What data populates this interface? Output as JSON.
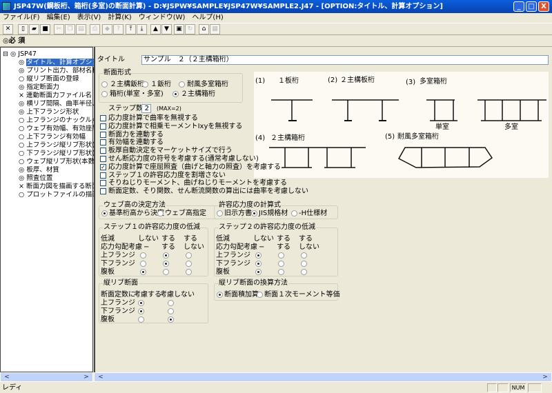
{
  "window": {
    "title": "JSP47W(鋼板桁、箱桁(多室)の断面計算) - D:¥JSPW¥SAMPLE¥JSP47W¥SAMPLE2.J47 - [OPTION:タイトル、計算オプション]",
    "minimize": "_",
    "maximize": "□",
    "close": "X"
  },
  "menu": [
    "ファイル(F)",
    "編集(E)",
    "表示(V)",
    "計算(K)",
    "ウィンドウ(W)",
    "ヘルプ(H)"
  ],
  "toolbar": [
    {
      "icon": "close-icon",
      "glyph": "✕"
    },
    {
      "icon": "new-file-icon",
      "glyph": "▯"
    },
    {
      "icon": "open-folder-icon",
      "glyph": "▰"
    },
    {
      "icon": "save-icon",
      "glyph": "■"
    },
    {
      "icon": "cut-icon",
      "glyph": "✂",
      "disabled": true
    },
    {
      "icon": "copy-icon",
      "glyph": "❐",
      "disabled": true
    },
    {
      "icon": "paste-icon",
      "glyph": "▤",
      "disabled": true
    },
    {
      "icon": "print-icon",
      "glyph": "⎙",
      "disabled": true
    },
    {
      "icon": "eraser-icon",
      "glyph": "◆",
      "disabled": true
    },
    {
      "icon": "help-bulb-icon",
      "glyph": "?",
      "disabled": true
    },
    {
      "icon": "move-top-icon",
      "glyph": "⤒"
    },
    {
      "icon": "move-bottom-icon",
      "glyph": "⤓"
    },
    {
      "icon": "move-up-icon",
      "glyph": "▲"
    },
    {
      "icon": "move-down-icon",
      "glyph": "▼"
    },
    {
      "icon": "window-icon",
      "glyph": "▣"
    },
    {
      "icon": "refresh-icon",
      "glyph": "↻",
      "disabled": true
    },
    {
      "icon": "home-icon",
      "glyph": "⌂"
    },
    {
      "icon": "grid-icon",
      "glyph": "▦",
      "disabled": true
    }
  ],
  "required_bar": "◎必 須",
  "tree": {
    "root": "JSP47",
    "items": [
      {
        "mark": "◎",
        "label": "タイトル、計算オプション",
        "selected": true
      },
      {
        "mark": "◎",
        "label": "プリント出力、部材名称、鋼材"
      },
      {
        "mark": "○",
        "label": "縦リブ断面の登録"
      },
      {
        "mark": "◎",
        "label": "指定断面力"
      },
      {
        "mark": "×",
        "label": "連動断面力ファイル名"
      },
      {
        "mark": "◎",
        "label": "横リブ間隔、曲率半径、ウェブ"
      },
      {
        "mark": "◎",
        "label": "上下フランジ形状"
      },
      {
        "mark": "○",
        "label": "上フランジのナックル点"
      },
      {
        "mark": "○",
        "label": "ウェブ有効幅、有効座屈長"
      },
      {
        "mark": "○",
        "label": "上下フランジ有効幅"
      },
      {
        "mark": "○",
        "label": "上フランジ縦リブ形状(本数、断"
      },
      {
        "mark": "○",
        "label": "下フランジ縦リブ形状(本数、断"
      },
      {
        "mark": "○",
        "label": "ウェブ縦リブ形状(本数、断面、"
      },
      {
        "mark": "◎",
        "label": "板厚、材質"
      },
      {
        "mark": "◎",
        "label": "照査位置"
      },
      {
        "mark": "×",
        "label": "断面力図を描画する断面力フ"
      },
      {
        "mark": "○",
        "label": "プロットファイルの描画スケール"
      }
    ]
  },
  "form": {
    "title_label": "タイトル",
    "title_value": "サンプル　２（２主構箱桁）",
    "section_type": {
      "label": "断面形式",
      "options": [
        "２主構鈑桁",
        "１鈑桁",
        "耐風多室箱桁",
        "箱桁(単室・多室)",
        "２主構箱桁"
      ],
      "selected": "２主構箱桁"
    },
    "steps_label": "ステップ数",
    "steps_value": "2",
    "steps_max": "(MAX=2)",
    "checkboxes": [
      {
        "label": "応力度計算で曲率を無視する",
        "checked": false
      },
      {
        "label": "応力度計算で相乗モーメントIxyを無視する",
        "checked": false
      },
      {
        "label": "断面力を連動する",
        "checked": false
      },
      {
        "label": "有効幅を連動する",
        "checked": false
      },
      {
        "label": "板厚自動決定をマーケットサイズで行う",
        "checked": false
      },
      {
        "label": "せん断応力度の符号を考慮する(通常考慮しない)",
        "checked": false
      },
      {
        "label": "応力度計算で座屈照査（曲げと軸力の照査）を考慮する",
        "checked": true
      },
      {
        "label": "ステップ１の許容応力度を割増さない",
        "checked": false
      },
      {
        "label": "そりねじりモーメント、曲げねじりモーメントを考慮する",
        "checked": false
      },
      {
        "label": "断面定数、そり関数、せん断流関数の算出には曲率を考慮しない",
        "checked": false
      }
    ],
    "web_height": {
      "label": "ウェブ高の決定方法",
      "options": [
        "基準桁高から決定",
        "ウェブ高指定"
      ],
      "selected": "基準桁高から決定"
    },
    "allowable_formula": {
      "label": "許容応力度の計算式",
      "options": [
        "旧示方書",
        "JIS規格材",
        "-H仕様材"
      ],
      "selected": "JIS規格材"
    },
    "step1": {
      "label": "ステップ１の許容応力度の低減",
      "header1": [
        "低減",
        "しない",
        "する",
        "する"
      ],
      "header2": [
        "応力勾配考慮",
        "−",
        "する",
        "しない"
      ],
      "rows": [
        {
          "label": "上フランジ",
          "selected": 1
        },
        {
          "label": "下フランジ",
          "selected": 1
        },
        {
          "label": "腹板",
          "selected": 0
        }
      ]
    },
    "step2": {
      "label": "ステップ２の許容応力度の低減",
      "header1": [
        "低減",
        "しない",
        "する",
        "する"
      ],
      "header2": [
        "応力勾配考慮",
        "−",
        "する",
        "しない"
      ],
      "rows": [
        {
          "label": "上フランジ",
          "selected": 0
        },
        {
          "label": "下フランジ",
          "selected": 0
        },
        {
          "label": "腹板",
          "selected": 0
        }
      ]
    },
    "rib": {
      "label": "縦リブ断面",
      "header": [
        "断面定数に",
        "考慮する",
        "考慮しない"
      ],
      "rows": [
        {
          "label": "上フランジ",
          "selected": 0
        },
        {
          "label": "下フランジ",
          "selected": 0
        },
        {
          "label": "腹板",
          "selected": 1
        }
      ]
    },
    "rib_conv": {
      "label": "縦リブ断面の換算方法",
      "options": [
        "断面積加算",
        "断面１次モーメント等価"
      ],
      "selected": "断面積加算"
    }
  },
  "diagram": {
    "t1": "(1)",
    "l1": "１板桁",
    "t2": "(2)",
    "l2": "２主構板桁",
    "t3": "(3)",
    "l3": "多室箱桁",
    "single": "単室",
    "multi": "多室",
    "t4": "(4)",
    "l4": "２主構箱桁",
    "t5": "(5)",
    "l5": "耐風多室箱桁"
  },
  "status": {
    "text": "レディ",
    "num": "NUM"
  }
}
